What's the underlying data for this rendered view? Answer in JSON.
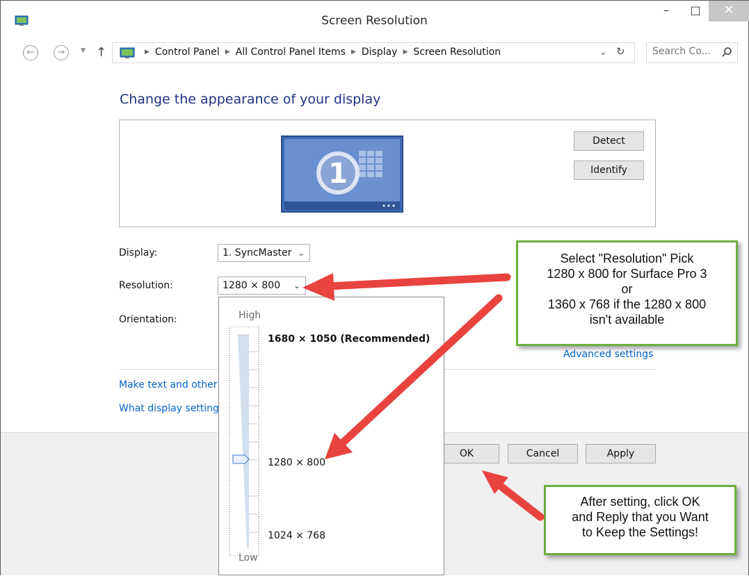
{
  "window": {
    "title": "Screen Resolution",
    "minimize": "–",
    "maximize": "□",
    "close": "✕"
  },
  "address": {
    "crumbs": [
      "Control Panel",
      "All Control Panel Items",
      "Display",
      "Screen Resolution"
    ],
    "search_placeholder": "Search Co..."
  },
  "content": {
    "heading": "Change the appearance of your display",
    "monitor_number": "1",
    "detect_label": "Detect",
    "identify_label": "Identify",
    "display_label": "Display:",
    "display_value": "1. SyncMaster",
    "resolution_label": "Resolution:",
    "resolution_value": "1280 × 800",
    "orientation_label": "Orientation:",
    "advanced_link": "Advanced settings",
    "link_text_size": "Make text and other",
    "link_what_settings": "What display setting"
  },
  "footer": {
    "ok_label": "OK",
    "cancel_label": "Cancel",
    "apply_label": "Apply"
  },
  "resolution_dropdown": {
    "high_label": "High",
    "low_label": "Low",
    "options": [
      "1680 × 1050 (Recommended)",
      "1280 × 800",
      "1024 × 768"
    ],
    "selected": "1280 × 800"
  },
  "callouts": {
    "top": [
      "Select \"Resolution\" Pick",
      "1280 x 800 for Surface Pro 3",
      "or",
      "1360 x 768 if the 1280 x 800",
      "isn't available"
    ],
    "bottom": [
      "After setting, click OK",
      "and Reply that you Want",
      "to Keep the Settings!"
    ]
  },
  "colors": {
    "heading": "#1e3287",
    "link": "#0066cc",
    "callout_border": "#6eae3e",
    "arrow": "#e8433f"
  }
}
